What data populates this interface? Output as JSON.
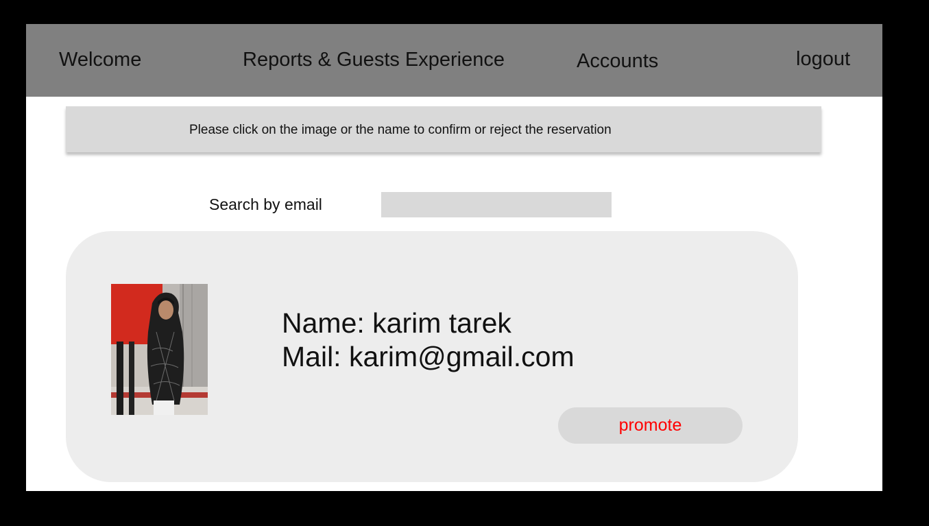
{
  "nav": {
    "welcome": "Welcome",
    "reports": "Reports & Guests Experience",
    "accounts": "Accounts",
    "logout": "logout"
  },
  "notice": {
    "text": "Please click on the image or the name to confirm or reject the reservation"
  },
  "search": {
    "label": "Search by email",
    "value": "",
    "placeholder": ""
  },
  "guest": {
    "name_line": "Name: karim tarek",
    "mail_line": "Mail: karim@gmail.com",
    "photo_alt": "guest photo",
    "promote_label": "promote"
  },
  "colors": {
    "navbar": "#808080",
    "notice": "#d9d9d9",
    "card": "#ededed",
    "promote_text": "#ff0000"
  }
}
